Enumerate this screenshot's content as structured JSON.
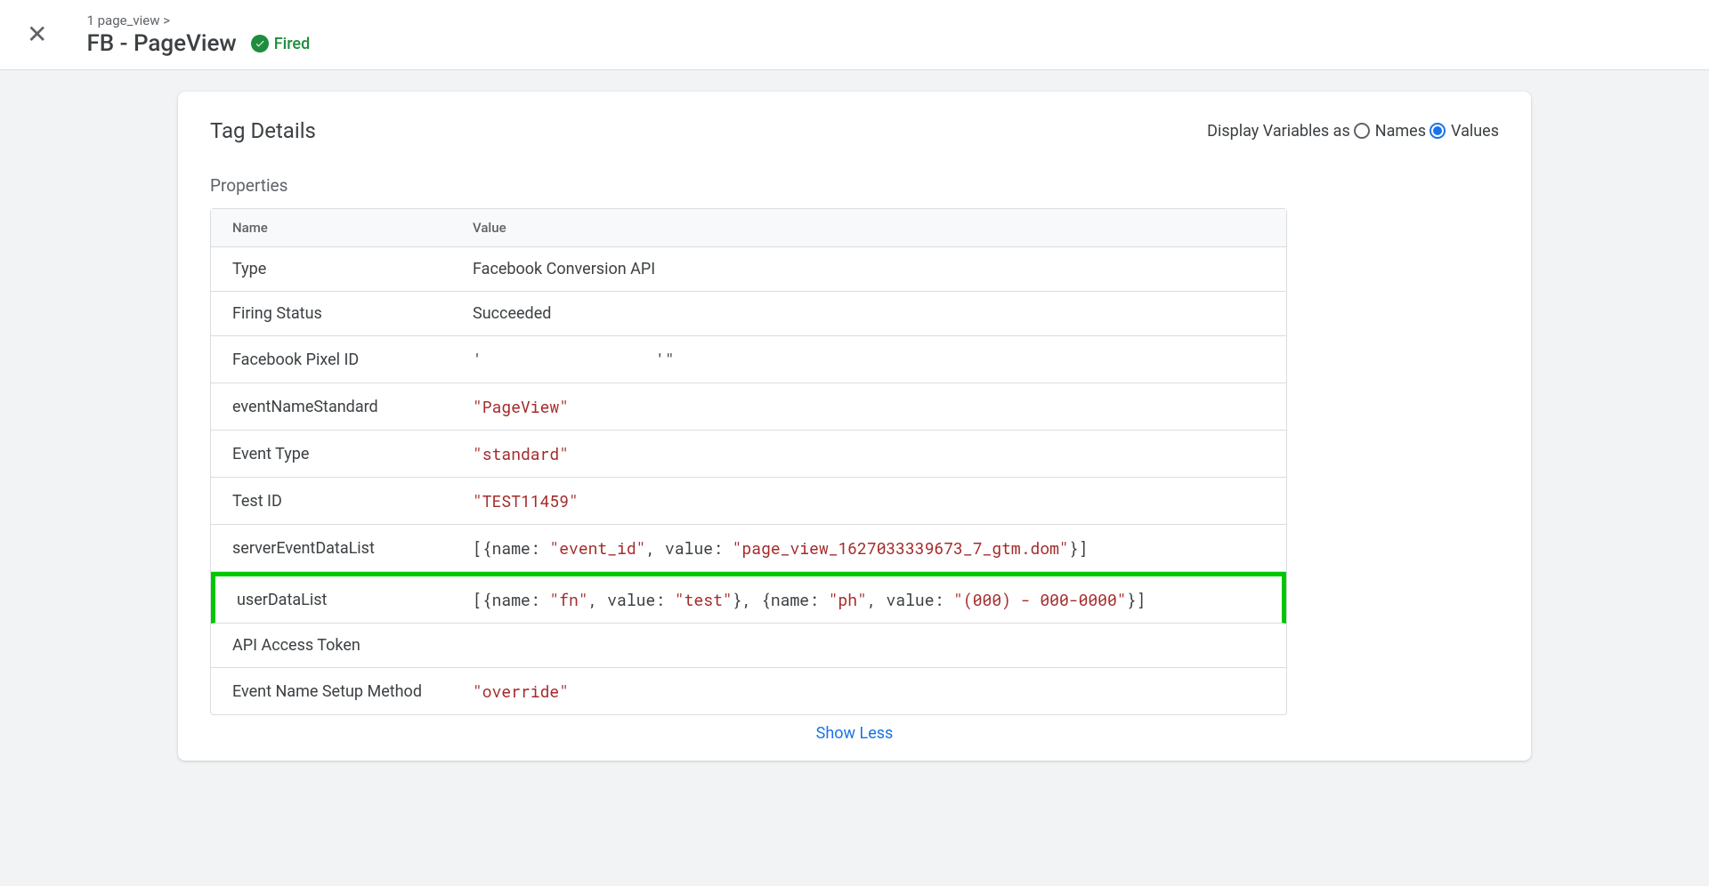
{
  "header": {
    "breadcrumb": "1 page_view >",
    "title": "FB - PageView",
    "status": "Fired"
  },
  "card": {
    "title": "Tag Details",
    "display_label": "Display Variables as",
    "radio_names": "Names",
    "radio_values": "Values",
    "section_label": "Properties",
    "col_name": "Name",
    "col_value": "Value",
    "show_less": "Show Less"
  },
  "rows": {
    "type": {
      "name": "Type",
      "value": "Facebook Conversion API"
    },
    "firing_status": {
      "name": "Firing Status",
      "value": "Succeeded"
    },
    "facebook_pixel_id": {
      "name": "Facebook Pixel ID",
      "value_html": "'                  '\""
    },
    "event_name_standard": {
      "name": "eventNameStandard",
      "value_html": "<span class=\"str\">\"PageView\"</span>"
    },
    "event_type": {
      "name": "Event Type",
      "value_html": "<span class=\"str\">\"standard\"</span>"
    },
    "test_id": {
      "name": "Test ID",
      "value_html": "<span class=\"str\">\"TEST11459\"</span>"
    },
    "server_event_data_list": {
      "name": "serverEventDataList",
      "value_html": "[{name: <span class=\"str\">\"event_id\"</span>, value: <span class=\"str\">\"page_view_1627033339673_7_gtm.dom\"</span>}]"
    },
    "user_data_list": {
      "name": "userDataList",
      "value_html": "[{name: <span class=\"str\">\"fn\"</span>, value: <span class=\"str\">\"test\"</span>}, {name: <span class=\"str\">\"ph\"</span>, value: <span class=\"str\">\"(000) - 000-0000\"</span>}]"
    },
    "api_access_token": {
      "name": "API Access Token",
      "value": ""
    },
    "event_name_setup_method": {
      "name": "Event Name Setup Method",
      "value_html": "<span class=\"str\">\"override\"</span>"
    }
  }
}
